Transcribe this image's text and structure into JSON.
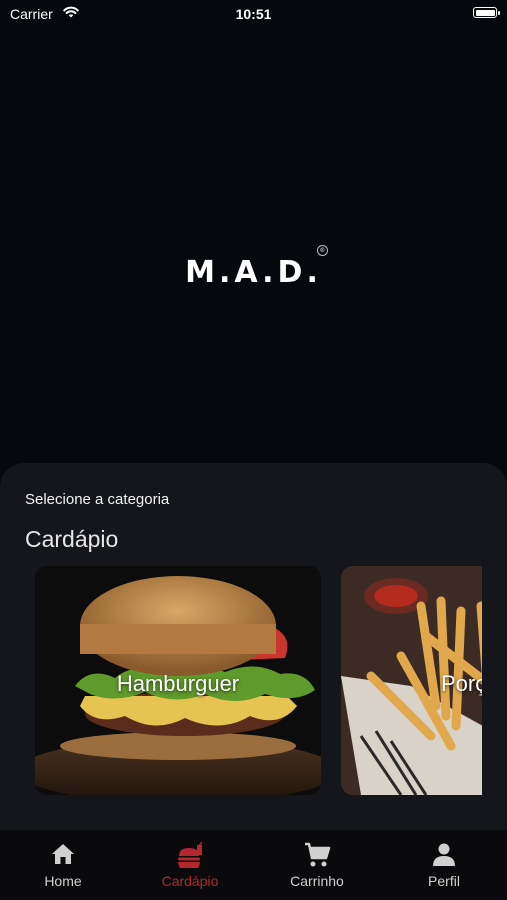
{
  "status_bar": {
    "carrier": "Carrier",
    "time": "10:51",
    "battery_level": 1.0
  },
  "brand": {
    "logo_text": "M.A.D.",
    "registered_mark": "®"
  },
  "sheet": {
    "select_label": "Selecione a categoria",
    "section_title": "Cardápio",
    "categories": [
      {
        "label": "Hamburguer"
      },
      {
        "label": "Porções"
      }
    ]
  },
  "tab_bar": {
    "active_color": "#b3282d",
    "items": [
      {
        "label": "Home",
        "icon": "home-icon"
      },
      {
        "label": "Cardápio",
        "icon": "burger-icon",
        "active": true
      },
      {
        "label": "Carrinho",
        "icon": "cart-icon"
      },
      {
        "label": "Perfil",
        "icon": "person-icon"
      }
    ]
  }
}
